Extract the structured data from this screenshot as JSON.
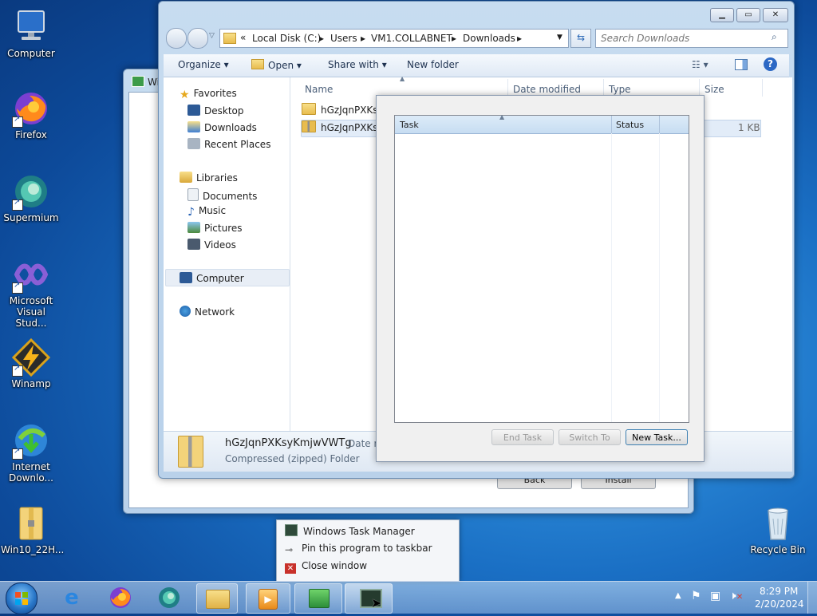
{
  "desktop": {
    "icons": [
      {
        "label": "Computer"
      },
      {
        "label": "Firefox"
      },
      {
        "label": "Supermium"
      },
      {
        "label": "Microsoft Visual Stud..."
      },
      {
        "label": "Winamp"
      },
      {
        "label": "Internet Downlo..."
      },
      {
        "label": "Win10_22H..."
      },
      {
        "label": "Recycle Bin"
      }
    ]
  },
  "background_window": {
    "title": "Wi",
    "back_label": "Back",
    "install_label": "Install"
  },
  "explorer": {
    "address": {
      "chevron": "«",
      "crumbs": [
        "Local Disk (C:)",
        "Users",
        "VM1.COLLABNET",
        "Downloads"
      ]
    },
    "search_placeholder": "Search Downloads",
    "toolbar": {
      "organize": "Organize",
      "open": "Open",
      "share_with": "Share with",
      "new_folder": "New folder"
    },
    "nav": {
      "favorites": "Favorites",
      "desktop": "Desktop",
      "downloads": "Downloads",
      "recent_places": "Recent Places",
      "libraries": "Libraries",
      "documents": "Documents",
      "music": "Music",
      "pictures": "Pictures",
      "videos": "Videos",
      "computer": "Computer",
      "network": "Network"
    },
    "columns": {
      "name": "Name",
      "date_modified": "Date modified",
      "type": "Type",
      "size": "Size"
    },
    "files": [
      {
        "name": "hGzJqnPXKsy"
      },
      {
        "name": "hGzJqnPXKsy",
        "size": "1 KB"
      }
    ],
    "details": {
      "name": "hGzJqnPXKsyKmjwVWTg",
      "date_label": "Date m",
      "type": "Compressed (zipped) Folder"
    }
  },
  "task_manager": {
    "columns": {
      "task": "Task",
      "status": "Status"
    },
    "buttons": {
      "end_task": "End Task",
      "switch_to": "Switch To",
      "new_task": "New Task..."
    }
  },
  "jump_list": {
    "items": [
      {
        "label": "Windows Task Manager"
      },
      {
        "label": "Pin this program to taskbar"
      },
      {
        "label": "Close window"
      }
    ]
  },
  "taskbar": {
    "time": "8:29 PM",
    "date": "2/20/2024"
  }
}
